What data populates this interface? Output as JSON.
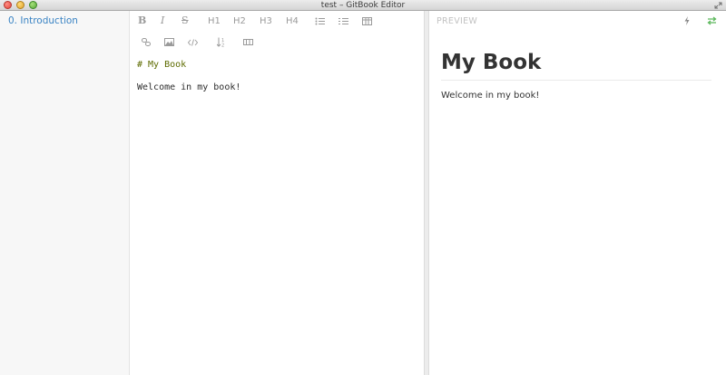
{
  "window": {
    "title": "test – GitBook Editor"
  },
  "summary": {
    "chapters": [
      {
        "label": "0. Introduction"
      }
    ]
  },
  "toolbar": {
    "bold": "B",
    "italic": "I",
    "strike": "S",
    "h1": "H1",
    "h2": "H2",
    "h3": "H3",
    "h4": "H4",
    "icons": [
      "unordered-list-icon",
      "ordered-list-icon",
      "table-icon",
      "link-icon",
      "image-icon",
      "code-icon",
      "sort-icon",
      "horizontal-rule-icon"
    ]
  },
  "editor": {
    "lines": [
      "# My Book",
      "Welcome in my book!"
    ]
  },
  "preview": {
    "label": "PREVIEW",
    "title": "My Book",
    "paragraph": "Welcome in my book!"
  },
  "colors": {
    "link": "#3b84c4",
    "markdown_heading": "#5d6b00",
    "sync_icon": "#5cb85c",
    "toolbar": "#9a9a9a"
  }
}
